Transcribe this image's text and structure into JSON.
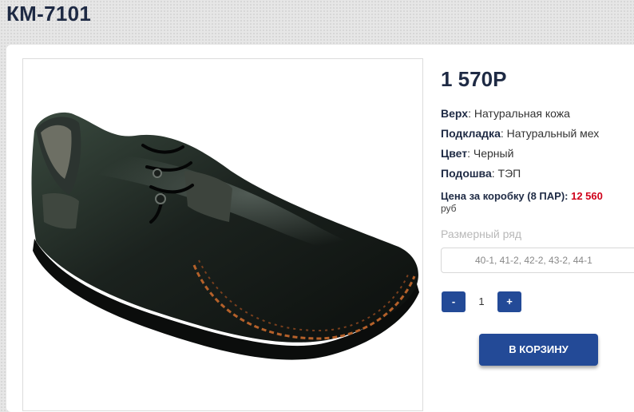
{
  "product": {
    "title": "КМ-7101",
    "price": "1 570Р",
    "specs": [
      {
        "label": "Верх",
        "value": ": Натуральная кожа"
      },
      {
        "label": "Подкладка",
        "value": ": Натуральный мех"
      },
      {
        "label": "Цвет",
        "value": ": Черный"
      },
      {
        "label": "Подошва",
        "value": ": ТЭП"
      }
    ],
    "box_price_label": "Цена за коробку (8 ПАР):",
    "box_price_value": "12 560",
    "box_price_unit": "руб",
    "image_icon": "shoe-photo"
  },
  "size": {
    "label": "Размерный ряд",
    "selected": "40-1, 41-2, 42-2, 43-2, 44-1"
  },
  "quantity": {
    "minus_label": "-",
    "value": "1",
    "plus_label": "+"
  },
  "cart": {
    "button_label": "В КОРЗИНУ"
  },
  "colors": {
    "accent": "#234a97",
    "title": "#1e2a44",
    "price_highlight": "#d0021b"
  }
}
